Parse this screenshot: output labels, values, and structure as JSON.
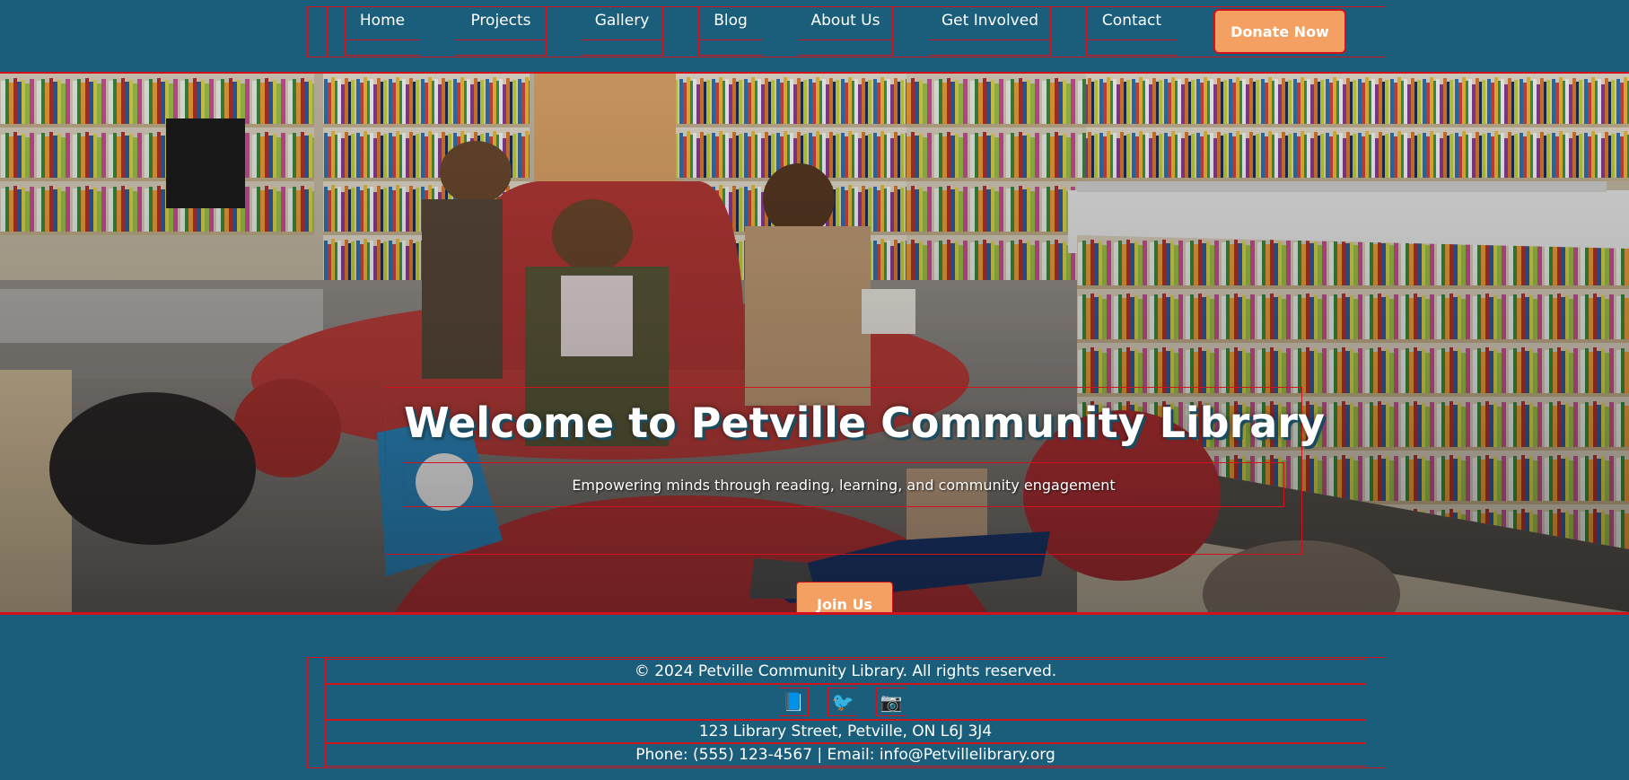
{
  "nav": {
    "links": [
      {
        "label": "Home"
      },
      {
        "label": "Projects"
      },
      {
        "label": "Gallery"
      },
      {
        "label": "Blog"
      },
      {
        "label": "About Us"
      },
      {
        "label": "Get Involved"
      },
      {
        "label": "Contact"
      }
    ],
    "donate_label": "Donate Now"
  },
  "hero": {
    "title": "Welcome to Petville Community Library",
    "subtitle": "Empowering minds through reading, learning, and community engagement",
    "cta_label": "Join Us"
  },
  "footer": {
    "copyright": "© 2024 Petville Community Library. All rights reserved.",
    "social": [
      {
        "icon": "book-icon",
        "glyph": "📘"
      },
      {
        "icon": "bird-icon",
        "glyph": "🐦"
      },
      {
        "icon": "camera-icon",
        "glyph": "📷"
      }
    ],
    "address": "123 Library Street, Petville, ON L6J 3J4",
    "contact": "Phone: (555) 123-4567 | Email: info@Petvillelibrary.org"
  },
  "colors": {
    "background": "#1b5e7b",
    "accent": "#f4a062",
    "outline": "#d0121d"
  }
}
